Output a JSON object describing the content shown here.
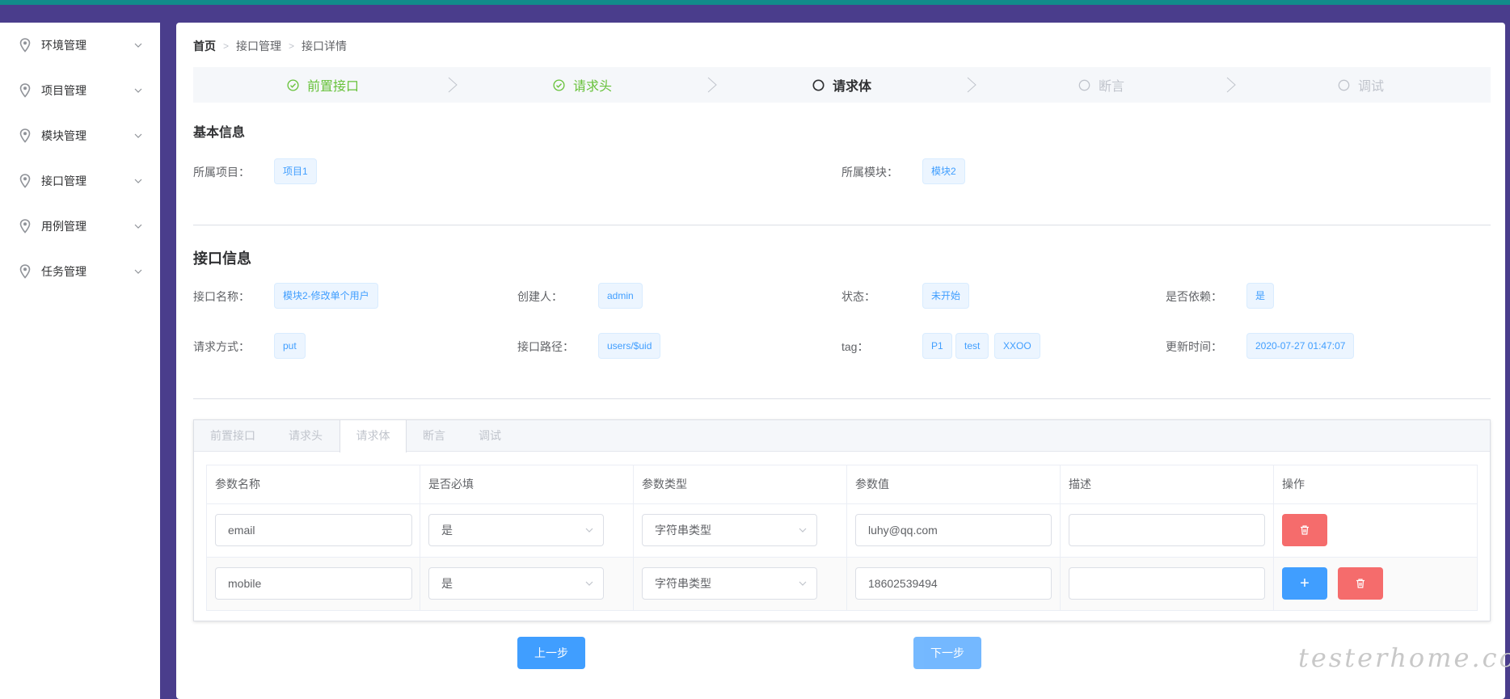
{
  "sidebar": {
    "items": [
      {
        "label": "环境管理"
      },
      {
        "label": "项目管理"
      },
      {
        "label": "模块管理"
      },
      {
        "label": "接口管理"
      },
      {
        "label": "用例管理"
      },
      {
        "label": "任务管理"
      }
    ]
  },
  "breadcrumb": [
    "首页",
    "接口管理",
    "接口详情"
  ],
  "steps": [
    {
      "label": "前置接口",
      "status": "done"
    },
    {
      "label": "请求头",
      "status": "done"
    },
    {
      "label": "请求体",
      "status": "active"
    },
    {
      "label": "断言",
      "status": "wait"
    },
    {
      "label": "调试",
      "status": "wait"
    }
  ],
  "basic_info": {
    "title": "基本信息",
    "project_label": "所属项目：",
    "project_value": "项目1",
    "module_label": "所属模块：",
    "module_value": "模块2"
  },
  "api_info": {
    "title": "接口信息",
    "name_label": "接口名称：",
    "name_value": "模块2-修改单个用户",
    "creator_label": "创建人：",
    "creator_value": "admin",
    "status_label": "状态：",
    "status_value": "未开始",
    "depend_label": "是否依赖：",
    "depend_value": "是",
    "method_label": "请求方式：",
    "method_value": "put",
    "path_label": "接口路径：",
    "path_value": "users/$uid",
    "tag_label": "tag：",
    "tags": [
      "P1",
      "test",
      "XXOO"
    ],
    "updated_label": "更新时间：",
    "updated_value": "2020-07-27 01:47:07"
  },
  "tabs": [
    "前置接口",
    "请求头",
    "请求体",
    "断言",
    "调试"
  ],
  "table": {
    "headers": [
      "参数名称",
      "是否必填",
      "参数类型",
      "参数值",
      "描述",
      "操作"
    ],
    "rows": [
      {
        "name": "email",
        "required": "是",
        "type": "字符串类型",
        "value": "luhy@qq.com",
        "desc": ""
      },
      {
        "name": "mobile",
        "required": "是",
        "type": "字符串类型",
        "value": "18602539494",
        "desc": ""
      }
    ],
    "add_label": "+"
  },
  "buttons": {
    "prev": "上一步",
    "next": "下一步"
  },
  "watermark": "testerhome.com",
  "colors": {
    "primary": "#409eff",
    "success": "#67c23a",
    "danger": "#f56c6c",
    "frame": "#4a3d8c",
    "topbar": "#118c8a"
  }
}
